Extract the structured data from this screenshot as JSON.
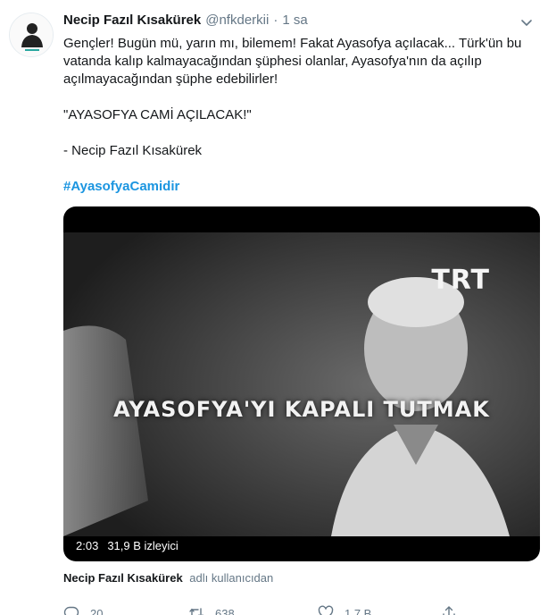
{
  "tweet": {
    "author": {
      "display_name": "Necip Fazıl Kısakürek",
      "handle": "@nfkderkii",
      "separator": "·",
      "time": "1 sa",
      "avatar_icon": "nfk-logo-icon"
    },
    "text": {
      "line_main": "Gençler! Bugün mü, yarın mı, bilemem! Fakat Ayasofya açılacak... Türk'ün bu vatanda kalıp kalmayacağından şüphesi olanlar, Ayasofya'nın da açılıp açılmayacağından şüphe edebilirler!",
      "quote": "\"AYASOFYA CAMİ AÇILACAK!\"",
      "signature": "- Necip Fazıl Kısakürek",
      "hashtag": "#AyasofyaCamidir"
    },
    "media": {
      "watermark": "TRT",
      "caption": "AYASOFYA'YI KAPALI TUTMAK",
      "duration": "2:03",
      "views": "31,9 B izleyici"
    },
    "via": {
      "name": "Necip Fazıl Kısakürek",
      "suffix": "adlı kullanıcıdan"
    },
    "actions": {
      "reply_count": "20",
      "retweet_count": "638",
      "like_count": "1,7 B"
    }
  },
  "colors": {
    "accent": "#1b95e0",
    "secondary_text": "#657786",
    "primary_text": "#14171a"
  }
}
